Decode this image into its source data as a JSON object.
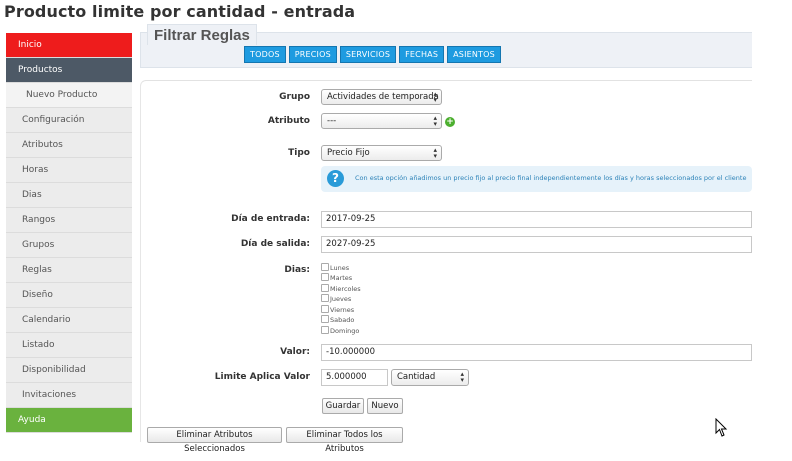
{
  "page": {
    "title": "Producto limite por cantidad - entrada"
  },
  "sidebar": {
    "items": [
      {
        "label": "Inicio"
      },
      {
        "label": "Productos"
      },
      {
        "label": "Nuevo Producto"
      },
      {
        "label": "Configuración"
      },
      {
        "label": "Atributos"
      },
      {
        "label": "Horas"
      },
      {
        "label": "Dias"
      },
      {
        "label": "Rangos"
      },
      {
        "label": "Grupos"
      },
      {
        "label": "Reglas"
      },
      {
        "label": "Diseño"
      },
      {
        "label": "Calendario"
      },
      {
        "label": "Listado"
      },
      {
        "label": "Disponibilidad"
      },
      {
        "label": "Invitaciones"
      },
      {
        "label": "Ayuda"
      }
    ]
  },
  "filter": {
    "legend": "Filtrar Reglas",
    "buttons": [
      "TODOS",
      "PRECIOS",
      "SERVICIOS",
      "FECHAS",
      "ASIENTOS"
    ]
  },
  "form": {
    "grupo_label": "Grupo",
    "grupo_value": "Actividades de temporada",
    "atributo_label": "Atributo",
    "atributo_value": "---",
    "tipo_label": "Tipo",
    "tipo_value": "Precio Fijo",
    "info_text": "Con esta opción añadimos un precio fijo al precio final independientemente los días y horas seleccionados por el cliente",
    "entrada_label": "Día de entrada:",
    "entrada_value": "2017-09-25",
    "salida_label": "Día de salida:",
    "salida_value": "2027-09-25",
    "dias_label": "Dias:",
    "days": [
      "Lunes",
      "Martes",
      "Miercoles",
      "Jueves",
      "Viernes",
      "Sabado",
      "Domingo"
    ],
    "valor_label": "Valor:",
    "valor_value": "-10.000000",
    "limite_label": "Limite Aplica Valor",
    "limite_value": "5.000000",
    "limite_unit": "Cantidad",
    "guardar_label": "Guardar",
    "nuevo_label": "Nuevo"
  },
  "bottom": {
    "eliminar_sel_label": "Eliminar Atributos Seleccionados",
    "eliminar_todos_label": "Eliminar Todos los Atributos"
  },
  "colors": {
    "inicio": "#ee1c1c",
    "productos": "#4d5966",
    "ayuda": "#6ab23e",
    "filter_button": "#1e9be0",
    "info_bg": "#e6f2fa"
  }
}
